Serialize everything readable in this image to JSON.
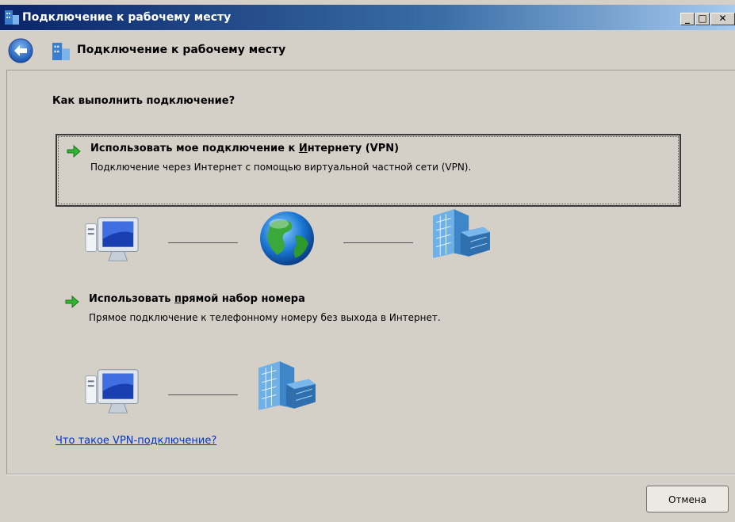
{
  "window": {
    "title": "Подключение к рабочему месту",
    "controls": [
      "minimize-icon",
      "maximize-icon",
      "close-icon"
    ]
  },
  "nav": {
    "title": "Подключение к рабочему месту"
  },
  "main": {
    "question": "Как выполнить подключение?",
    "options": [
      {
        "title_pre": "Использовать мое подключение к ",
        "title_underline": "И",
        "title_post": "нтернету (VPN)",
        "description": "Подключение через Интернет с помощью виртуальной частной сети (VPN).",
        "selected": true,
        "diagram": [
          "computer-icon",
          "globe-icon",
          "office-building-icon"
        ]
      },
      {
        "title_pre": "Использовать ",
        "title_underline": "п",
        "title_post": "рямой набор номера",
        "description": "Прямое подключение к телефонному номеру без выхода в Интернет.",
        "selected": false,
        "diagram": [
          "computer-icon",
          "office-building-icon"
        ]
      }
    ],
    "help_link": "Что такое VPN-подключение?"
  },
  "footer": {
    "cancel_label": "Отмена"
  },
  "colors": {
    "window_bg": "#d4d0c8",
    "titlebar_start": "#0a246a",
    "titlebar_end": "#a6caf0",
    "link": "#0033cc",
    "arrow_green": "#2fb52f"
  }
}
